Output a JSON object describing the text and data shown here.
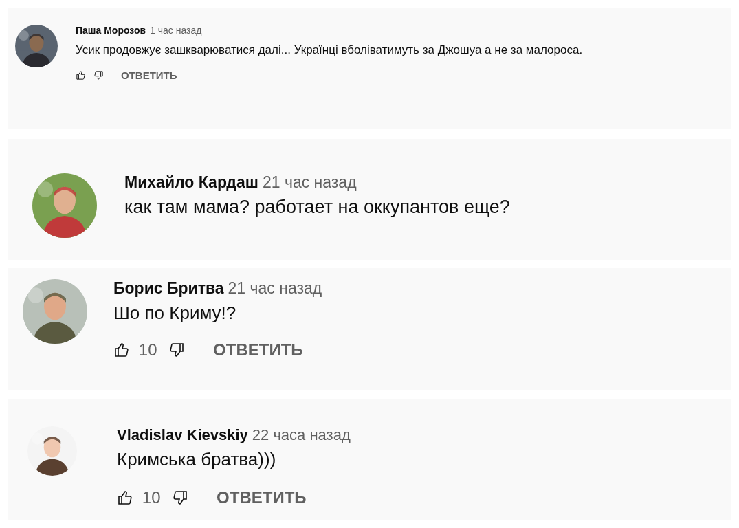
{
  "comments": [
    {
      "author": "Паша Морозов",
      "time": "1 час назад",
      "text": "Усик продовжує зашкварюватися далі... Українці вболіватимуть за Джошуа а не за малороса.",
      "actions": {
        "reply": "ОТВЕТИТЬ"
      }
    },
    {
      "author": "Михайло Кардаш",
      "time": "21 час назад",
      "text": "как там мама? работает на оккупантов еще?"
    },
    {
      "author": "Борис Бритва",
      "time": "21 час назад",
      "text": "Шо по Криму!?",
      "actions": {
        "likes": "10",
        "reply": "ОТВЕТИТЬ"
      }
    },
    {
      "author": "Vladislav Kievskiy",
      "time": "22 часа назад",
      "text": "Кримська братва)))",
      "actions": {
        "likes": "10",
        "reply": "ОТВЕТИТЬ"
      }
    }
  ]
}
